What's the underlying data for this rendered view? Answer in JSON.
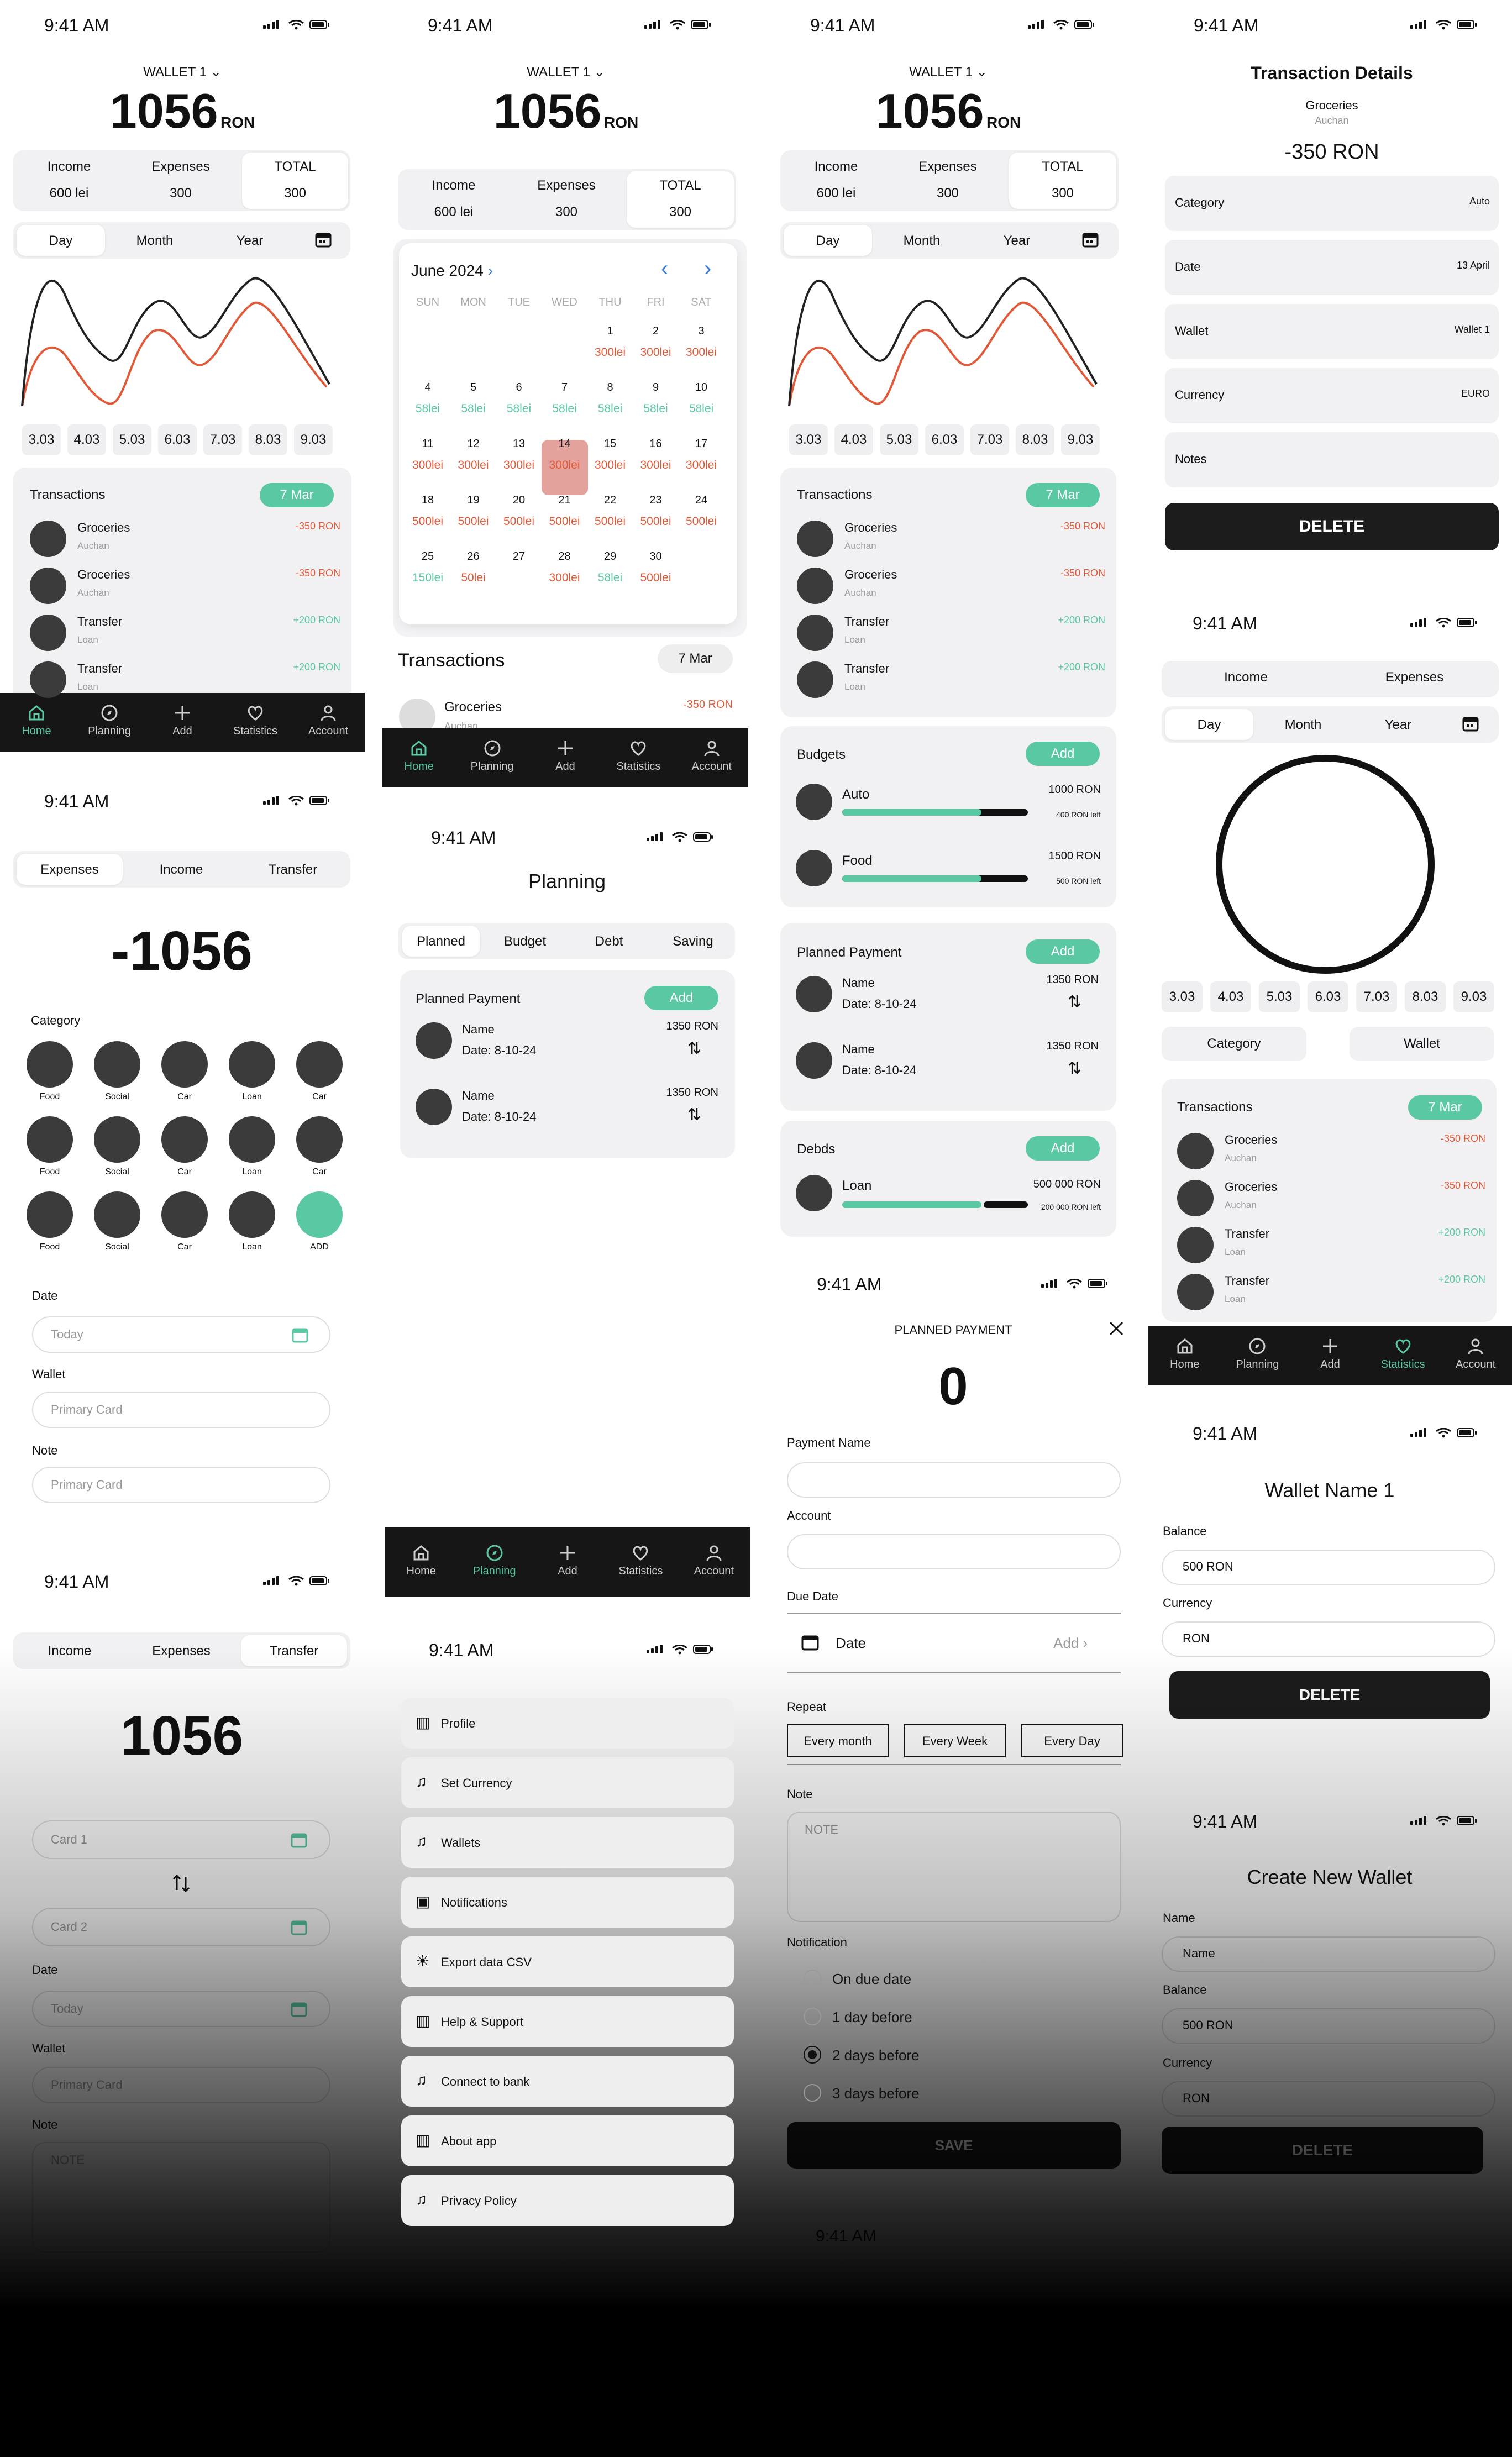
{
  "status": {
    "time": "9:41 AM"
  },
  "home": {
    "wallet": "WALLET 1",
    "balance": "1056",
    "currency": "RON",
    "income_label": "Income",
    "income_value": "600 lei",
    "expenses_label": "Expenses",
    "expenses_value": "300",
    "total_label": "TOTAL",
    "total_value": "300",
    "periods": [
      "Day",
      "Month",
      "Year"
    ],
    "dates": [
      "3.03",
      "4.03",
      "5.03",
      "6.03",
      "7.03",
      "8.03",
      "9.03"
    ],
    "transactions_title": "Transactions",
    "transactions_date": "7 Mar",
    "transactions": [
      {
        "name": "Groceries",
        "sub": "Auchan",
        "amount": "-350 RON"
      },
      {
        "name": "Groceries",
        "sub": "Auchan",
        "amount": "-350 RON"
      },
      {
        "name": "Transfer",
        "sub": "Loan",
        "amount": "+200 RON"
      },
      {
        "name": "Transfer",
        "sub": "Loan",
        "amount": "+200 RON"
      }
    ]
  },
  "nav": {
    "items": [
      "Home",
      "Planning",
      "Add",
      "Statistics",
      "Account"
    ]
  },
  "calendar": {
    "month": "June 2024",
    "weekdays": [
      "SUN",
      "MON",
      "TUE",
      "WED",
      "THU",
      "FRI",
      "SAT"
    ],
    "days": [
      {
        "d": "1",
        "v": "300lei",
        "t": "red"
      },
      {
        "d": "2",
        "v": "300lei",
        "t": "red"
      },
      {
        "d": "3",
        "v": "300lei",
        "t": "red"
      },
      {
        "d": "4",
        "v": "58lei",
        "t": "teal"
      },
      {
        "d": "5",
        "v": "58lei",
        "t": "teal"
      },
      {
        "d": "6",
        "v": "58lei",
        "t": "teal"
      },
      {
        "d": "7",
        "v": "58lei",
        "t": "teal"
      },
      {
        "d": "8",
        "v": "58lei",
        "t": "teal"
      },
      {
        "d": "9",
        "v": "58lei",
        "t": "teal"
      },
      {
        "d": "10",
        "v": "58lei",
        "t": "teal"
      },
      {
        "d": "11",
        "v": "300lei",
        "t": "red"
      },
      {
        "d": "12",
        "v": "300lei",
        "t": "red"
      },
      {
        "d": "13",
        "v": "300lei",
        "t": "red"
      },
      {
        "d": "14",
        "v": "300lei",
        "t": "red"
      },
      {
        "d": "15",
        "v": "300lei",
        "t": "red"
      },
      {
        "d": "16",
        "v": "300lei",
        "t": "red"
      },
      {
        "d": "17",
        "v": "300lei",
        "t": "red"
      },
      {
        "d": "18",
        "v": "500lei",
        "t": "red"
      },
      {
        "d": "19",
        "v": "500lei",
        "t": "red"
      },
      {
        "d": "20",
        "v": "500lei",
        "t": "red"
      },
      {
        "d": "21",
        "v": "500lei",
        "t": "red"
      },
      {
        "d": "22",
        "v": "500lei",
        "t": "red"
      },
      {
        "d": "23",
        "v": "500lei",
        "t": "red"
      },
      {
        "d": "24",
        "v": "500lei",
        "t": "red"
      },
      {
        "d": "25",
        "v": "150lei",
        "t": "teal"
      },
      {
        "d": "26",
        "v": "50lei",
        "t": "red"
      },
      {
        "d": "27",
        "v": "",
        "t": "red"
      },
      {
        "d": "28",
        "v": "300lei",
        "t": "red"
      },
      {
        "d": "29",
        "v": "58lei",
        "t": "teal"
      },
      {
        "d": "30",
        "v": "500lei",
        "t": "red"
      }
    ],
    "transactions_title": "Transactions",
    "transactions_date": "7 Mar",
    "first_name": "Groceries",
    "first_sub": "Auchan",
    "first_amount": "-350 RON"
  },
  "budgets": {
    "title": "Budgets",
    "add": "Add",
    "items": [
      {
        "name": "Auto",
        "amount": "1000 RON",
        "left": "400 RON left",
        "progress": 0.75
      },
      {
        "name": "Food",
        "amount": "1500 RON",
        "left": "500 RON left",
        "progress": 0.75
      }
    ]
  },
  "planned": {
    "title": "Planned Payment",
    "add": "Add",
    "items": [
      {
        "name": "Name",
        "date": "Date: 8-10-24",
        "amount": "1350 RON"
      },
      {
        "name": "Name",
        "date": "Date: 8-10-24",
        "amount": "1350 RON"
      }
    ]
  },
  "debts": {
    "title": "Debds",
    "add": "Add",
    "name": "Loan",
    "amount": "500 000 RON",
    "left": "200 000 RON left",
    "progress": 0.75
  },
  "details": {
    "title": "Transaction Details",
    "name": "Groceries",
    "sub": "Auchan",
    "amount": "-350 RON",
    "rows": [
      {
        "label": "Category",
        "value": "Auto"
      },
      {
        "label": "Date",
        "value": "13 April"
      },
      {
        "label": "Wallet",
        "value": "Wallet 1"
      },
      {
        "label": "Currency",
        "value": "EURO"
      },
      {
        "label": "Notes",
        "value": ""
      }
    ],
    "delete": "DELETE"
  },
  "stats": {
    "tabs": [
      "Income",
      "Expenses"
    ],
    "periods": [
      "Day",
      "Month",
      "Year"
    ],
    "dates": [
      "3.03",
      "4.03",
      "5.03",
      "6.03",
      "7.03",
      "8.03",
      "9.03"
    ],
    "filters": [
      "Category",
      "Wallet"
    ]
  },
  "add": {
    "tabs": [
      "Expenses",
      "Income",
      "Transfer"
    ],
    "amount": "-1056",
    "category_label": "Category",
    "categories": [
      "Food",
      "Social",
      "Car",
      "Loan",
      "Car",
      "Food",
      "Social",
      "Car",
      "Loan",
      "Car",
      "Food",
      "Social",
      "Car",
      "Loan",
      "ADD"
    ],
    "date_label": "Date",
    "date_placeholder": "Today",
    "wallet_label": "Wallet",
    "wallet_placeholder": "Primary Card",
    "note_label": "Note",
    "note_placeholder": "Primary Card"
  },
  "planning": {
    "title": "Planning",
    "tabs": [
      "Planned",
      "Budget",
      "Debt",
      "Saving"
    ]
  },
  "payment": {
    "title": "PLANNED PAYMENT",
    "amount": "0",
    "name_label": "Payment Name",
    "account_label": "Account",
    "due_label": "Due Date",
    "date_label": "Date",
    "date_add": "Add",
    "repeat_label": "Repeat",
    "repeat": [
      "Every month",
      "Every Week",
      "Every Day"
    ],
    "note_label": "Note",
    "note_placeholder": "NOTE",
    "notif_label": "Notification",
    "notif": [
      "On due date",
      "1 day before",
      "2 days before",
      "3 days before"
    ],
    "save": "SAVE"
  },
  "transfer": {
    "tabs": [
      "Income",
      "Expenses",
      "Transfer"
    ],
    "amount": "1056",
    "card1": "Card 1",
    "card2": "Card 2",
    "date_label": "Date",
    "date_placeholder": "Today",
    "wallet_label": "Wallet",
    "wallet_placeholder": "Primary Card",
    "note_label": "Note",
    "note_placeholder": "NOTE"
  },
  "account": {
    "items": [
      "Profile",
      "Set Currency",
      "Wallets",
      "Notifications",
      "Export data CSV",
      "Help & Support",
      "Connect to bank",
      "About app",
      "Privacy Policy"
    ]
  },
  "wallet_edit": {
    "title": "Wallet Name 1",
    "balance_label": "Balance",
    "balance": "500 RON",
    "currency_label": "Currency",
    "currency": "RON",
    "delete": "DELETE"
  },
  "wallet_new": {
    "title": "Create New Wallet",
    "name_label": "Name",
    "name": "Name",
    "balance_label": "Balance",
    "balance": "500 RON",
    "currency_label": "Currency",
    "currency": "RON",
    "delete": "DELETE"
  }
}
